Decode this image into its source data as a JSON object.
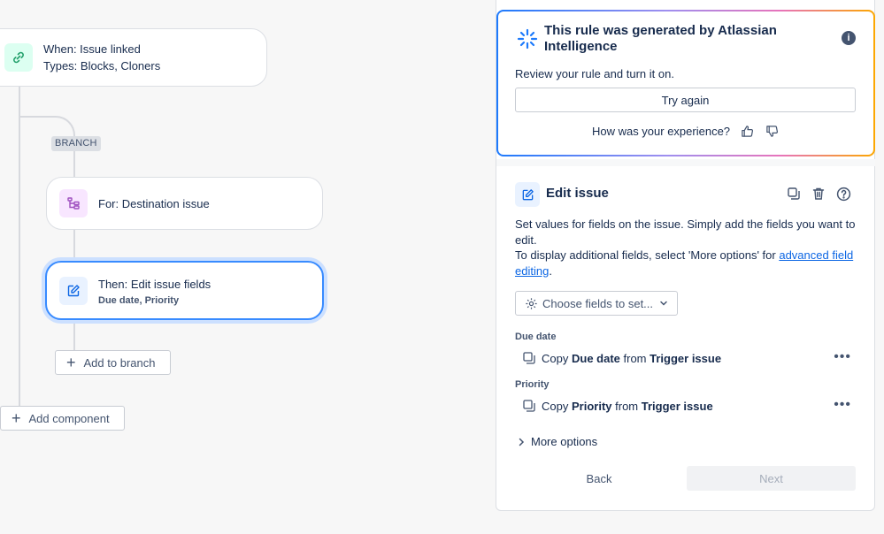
{
  "canvas": {
    "trigger": {
      "line1": "When: Issue linked",
      "line2": "Types: Blocks, Cloners",
      "icon": "link-icon"
    },
    "branch_badge": "BRANCH",
    "branch_node": {
      "label": "For: Destination issue",
      "icon": "branch-icon"
    },
    "action_node": {
      "label": "Then: Edit issue fields",
      "sub": "Due date, Priority",
      "icon": "edit-icon"
    },
    "add_to_branch": "Add to branch",
    "add_component": "Add component"
  },
  "ai_card": {
    "title": "This rule was generated by Atlassian Intelligence",
    "description": "Review your rule and turn it on.",
    "try_again": "Try again",
    "feedback_prompt": "How was your experience?"
  },
  "edit_issue": {
    "title": "Edit issue",
    "desc_line1": "Set values for fields on the issue. Simply add the fields you want to edit.",
    "desc_line2": "To display additional fields, select 'More options' for ",
    "desc_link": "advanced field editing",
    "desc_end": ".",
    "choose_fields": "Choose fields to set...",
    "fields": [
      {
        "label": "Due date",
        "prefix": "Copy",
        "field": "Due date",
        "from": "from",
        "source": "Trigger issue"
      },
      {
        "label": "Priority",
        "prefix": "Copy",
        "field": "Priority",
        "from": "from",
        "source": "Trigger issue"
      }
    ],
    "more_options": "More options",
    "back": "Back",
    "next": "Next"
  },
  "colors": {
    "accent": "#388bff",
    "link": "#0c66e4",
    "trigger_icon_bg": "#dcfff1",
    "branch_icon_bg": "#f8e6ff"
  }
}
